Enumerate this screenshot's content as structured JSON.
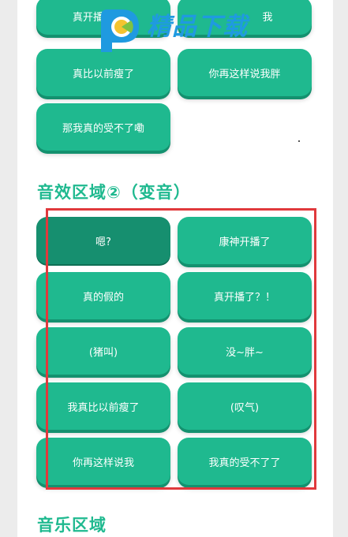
{
  "section1": {
    "buttons": [
      "真开播了？！",
      "我",
      "真比以前瘦了",
      "你再这样说我胖",
      "那我真的受不了嘞"
    ]
  },
  "section2": {
    "title": "音效区域②（变音）",
    "buttons": [
      "嗯?",
      "康神开播了",
      "真的假的",
      "真开播了？！",
      "(猪叫)",
      "没~胖~",
      "我真比以前瘦了",
      "(叹气)",
      "你再这样说我",
      "我真的受不了了"
    ]
  },
  "section3": {
    "title": "音乐区域"
  },
  "watermark": {
    "text": "精品下载"
  },
  "colors": {
    "accent": "#1fb98f",
    "pressed": "#168f6f",
    "highlight": "#e0393c",
    "watermark": "#1f9ae0"
  }
}
